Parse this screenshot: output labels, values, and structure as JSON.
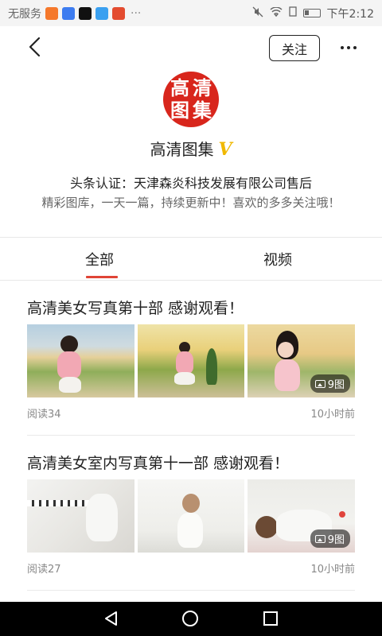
{
  "statusbar": {
    "carrier": "无服务",
    "time": "下午2:12",
    "dots": "···"
  },
  "header": {
    "follow_label": "关注"
  },
  "profile": {
    "avatar_chars": [
      "高",
      "清",
      "图",
      "集"
    ],
    "name": "高清图集",
    "verified_mark": "V",
    "certification": "头条认证：天津森炎科技发展有限公司售后",
    "bio": "精彩图库，一天一篇，持续更新中！喜欢的多多关注哦！"
  },
  "tabs": [
    {
      "label": "全部",
      "active": true
    },
    {
      "label": "视频",
      "active": false
    }
  ],
  "posts": [
    {
      "title": "高清美女写真第十部 感谢观看！",
      "image_count": "9图",
      "reads": "阅读34",
      "time": "10小时前"
    },
    {
      "title": "高清美女室内写真第十一部 感谢观看！",
      "image_count": "9图",
      "reads": "阅读27",
      "time": "10小时前"
    }
  ],
  "colors": {
    "accent": "#e04436",
    "avatar_bg": "#d8261c",
    "verified": "#f0b800"
  }
}
